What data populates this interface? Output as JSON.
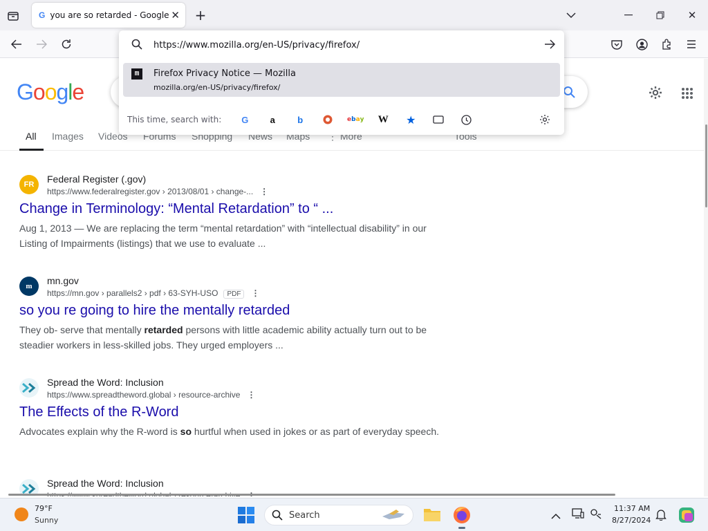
{
  "browser": {
    "tab_title": "you are so retarded - Google Se",
    "url": "https://www.mozilla.org/en-US/privacy/firefox/",
    "suggestion": {
      "title": "Firefox Privacy Notice — Mozilla",
      "url": "mozilla.org/en-US/privacy/firefox/"
    },
    "search_with_label": "This time, search with:",
    "engine_icons": [
      "google-icon",
      "amazon-icon",
      "bing-icon",
      "duckduckgo-icon",
      "ebay-icon",
      "wikipedia-icon",
      "bookmarks-icon",
      "tabs-icon",
      "history-icon"
    ]
  },
  "google": {
    "logo_letters": [
      "G",
      "o",
      "o",
      "g",
      "l",
      "e"
    ],
    "logo_colors": [
      "#4285f4",
      "#ea4335",
      "#fbbc05",
      "#4285f4",
      "#34a853",
      "#ea4335"
    ],
    "tabs": [
      "All",
      "Images",
      "Videos",
      "Forums",
      "Shopping",
      "News",
      "Maps",
      "More",
      "Tools"
    ],
    "results": [
      {
        "site": "Federal Register (.gov)",
        "favicon_text": "FR",
        "url": "https://www.federalregister.gov › 2013/08/01 › change-...",
        "title": "Change in Terminology: “Mental Retardation” to “ ...",
        "snippet": "Aug 1, 2013 — We are replacing the term “mental retardation” with “intellectual disability” in our Listing of Impairments (listings) that we use to evaluate ..."
      },
      {
        "site": "mn.gov",
        "favicon_text": "m",
        "url": "https://mn.gov › parallels2 › pdf › 63-SYH-USO",
        "pdf": "PDF",
        "title": "so you re going to hire the mentally retarded",
        "snippet_pre": "They ob- serve that mentally ",
        "snippet_bold": "retarded",
        "snippet_post": " persons with little academic ability actually turn out to be steadier workers in less-skilled jobs. They urged employers ..."
      },
      {
        "site": "Spread the Word: Inclusion",
        "url": "https://www.spreadtheword.global › resource-archive",
        "title": "The Effects of the R-Word",
        "snippet_pre": "Advocates explain why the R-word is ",
        "snippet_bold": "so",
        "snippet_post": " hurtful when used in jokes or as part of everyday speech."
      },
      {
        "site": "Spread the Word: Inclusion",
        "url": "https://www.spreadtheword.global › resource-archive"
      }
    ]
  },
  "taskbar": {
    "temperature": "79°F",
    "weather": "Sunny",
    "search_label": "Search",
    "time": "11:37 AM",
    "date": "8/27/2024"
  }
}
